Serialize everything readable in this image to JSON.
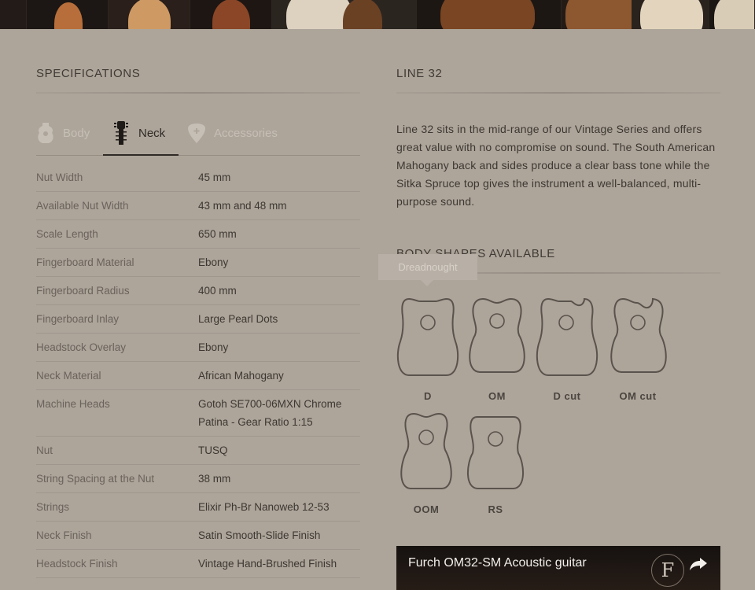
{
  "header_images": [
    {
      "name": "guitar-image-1"
    },
    {
      "name": "guitar-image-2"
    },
    {
      "name": "guitar-image-3"
    },
    {
      "name": "guitar-image-4"
    },
    {
      "name": "guitar-image-5"
    },
    {
      "name": "guitar-image-6"
    },
    {
      "name": "guitar-image-7"
    },
    {
      "name": "guitar-image-8"
    },
    {
      "name": "guitar-image-9"
    }
  ],
  "specifications": {
    "title": "SPECIFICATIONS",
    "tabs": [
      {
        "label": "Body",
        "icon": "guitar-body-icon",
        "active": false
      },
      {
        "label": "Neck",
        "icon": "guitar-neck-icon",
        "active": true
      },
      {
        "label": "Accessories",
        "icon": "pick-icon",
        "active": false
      }
    ],
    "rows": [
      {
        "key": "Nut Width",
        "value": "45 mm"
      },
      {
        "key": "Available Nut Width",
        "value": "43 mm and 48 mm"
      },
      {
        "key": "Scale Length",
        "value": "650 mm"
      },
      {
        "key": "Fingerboard Material",
        "value": "Ebony"
      },
      {
        "key": "Fingerboard Radius",
        "value": "400 mm"
      },
      {
        "key": "Fingerboard Inlay",
        "value": "Large Pearl Dots"
      },
      {
        "key": "Headstock Overlay",
        "value": "Ebony"
      },
      {
        "key": "Neck Material",
        "value": "African Mahogany"
      },
      {
        "key": "Machine Heads",
        "value": "Gotoh SE700-06MXN Chrome Patina - Gear Ratio 1:15"
      },
      {
        "key": "Nut",
        "value": "TUSQ"
      },
      {
        "key": "String Spacing at the Nut",
        "value": "38 mm"
      },
      {
        "key": "Strings",
        "value": "Elixir Ph-Br Nanoweb 12-53"
      },
      {
        "key": "Neck Finish",
        "value": "Satin Smooth-Slide Finish"
      },
      {
        "key": "Headstock Finish",
        "value": "Vintage Hand-Brushed Finish"
      }
    ]
  },
  "line": {
    "title": "LINE 32",
    "description": "Line 32 sits in the mid-range of our Vintage Series and offers great value with no compromise on sound. The South American Mahogany back and sides produce a clear bass tone while the Sitka Spruce top gives the instrument a well-balanced, multi-purpose sound."
  },
  "body_shapes": {
    "title": "BODY SHAPES AVAILABLE",
    "tooltip": "Dreadnought",
    "shapes": [
      {
        "label": "D",
        "icon": "dreadnought-shape-icon"
      },
      {
        "label": "OM",
        "icon": "om-shape-icon"
      },
      {
        "label": "D cut",
        "icon": "dreadnought-cutaway-shape-icon"
      },
      {
        "label": "OM cut",
        "icon": "om-cutaway-shape-icon"
      },
      {
        "label": "OOM",
        "icon": "oom-shape-icon"
      },
      {
        "label": "RS",
        "icon": "rs-shape-icon"
      }
    ]
  },
  "video": {
    "title": "Furch OM32-SM Acoustic guitar",
    "logo_text": "F",
    "share_icon": "share-arrow-icon"
  },
  "colors": {
    "background": "#ada59a",
    "header_strip": "#1c1714",
    "text_dark": "#3c3732",
    "text_muted": "#6a635c",
    "tab_inactive": "#c6bfb6"
  }
}
